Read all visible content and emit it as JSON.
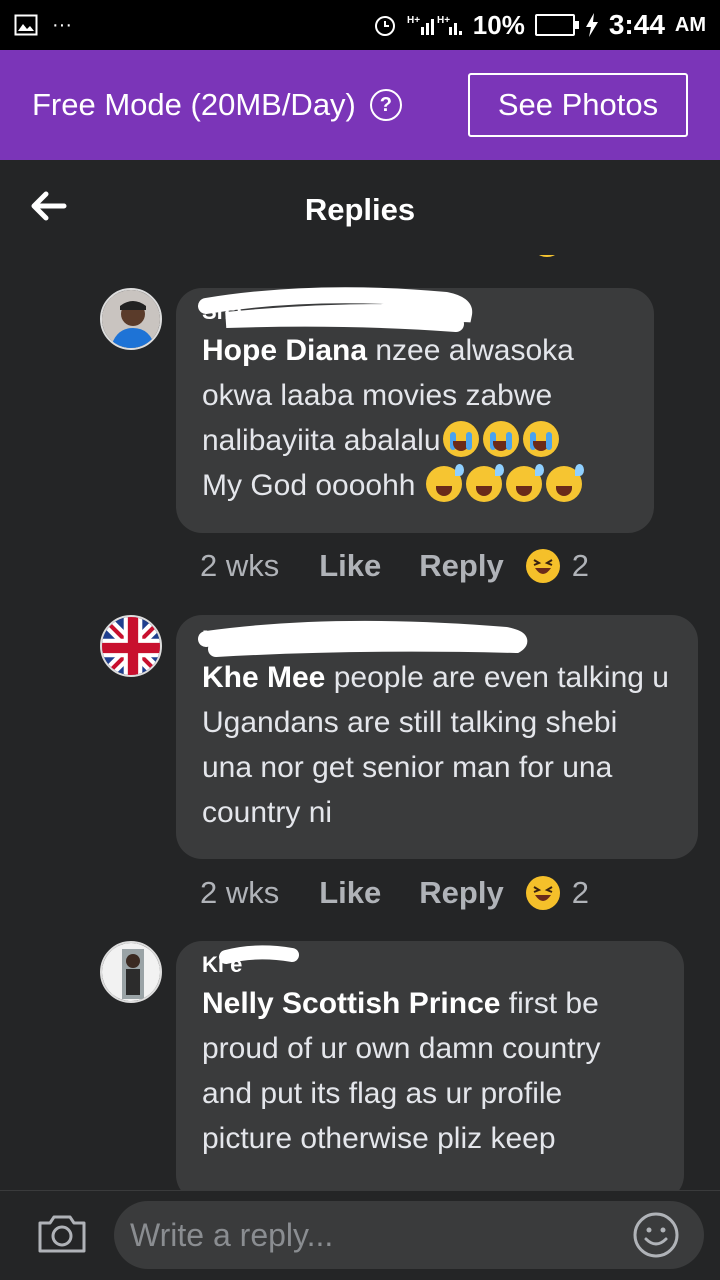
{
  "status_bar": {
    "battery": "10%",
    "time": "3:44",
    "ampm": "AM",
    "notification_dots": "···"
  },
  "free_mode": {
    "label": "Free Mode (20MB/Day)",
    "help_glyph": "?",
    "button": "See Photos"
  },
  "header": {
    "title": "Replies"
  },
  "comments": [
    {
      "obscured_name": "Sha",
      "mention": "Hope Diana",
      "text_1": "  nzee alwasoka okwa laaba movies zabwe nalibayiita abalalu",
      "text_2": "My God oooohh",
      "time": "2 wks",
      "like": "Like",
      "reply": "Reply",
      "reactions": "2",
      "emojis": [
        "loudly-crying-face",
        "loudly-crying-face",
        "loudly-crying-face",
        "grinning-sweat-face",
        "grinning-sweat-face",
        "grinning-sweat-face",
        "grinning-sweat-face"
      ]
    },
    {
      "obscured_name": "N",
      "mention": "Khe Mee",
      "text": " people are even talking u Ugandans are still talking shebi una nor get senior man for una country ni",
      "time": "2 wks",
      "like": "Like",
      "reply": "Reply",
      "reactions": "2"
    },
    {
      "obscured_name": "Kl        e",
      "mention": "Nelly Scottish Prince",
      "text": " first be proud of ur own damn country and put its flag as ur profile picture otherwise pliz keep"
    }
  ],
  "composer": {
    "placeholder": "Write a reply..."
  },
  "colors": {
    "accent": "#7b35b8",
    "bubble": "#3a3b3c",
    "background": "#242526"
  }
}
